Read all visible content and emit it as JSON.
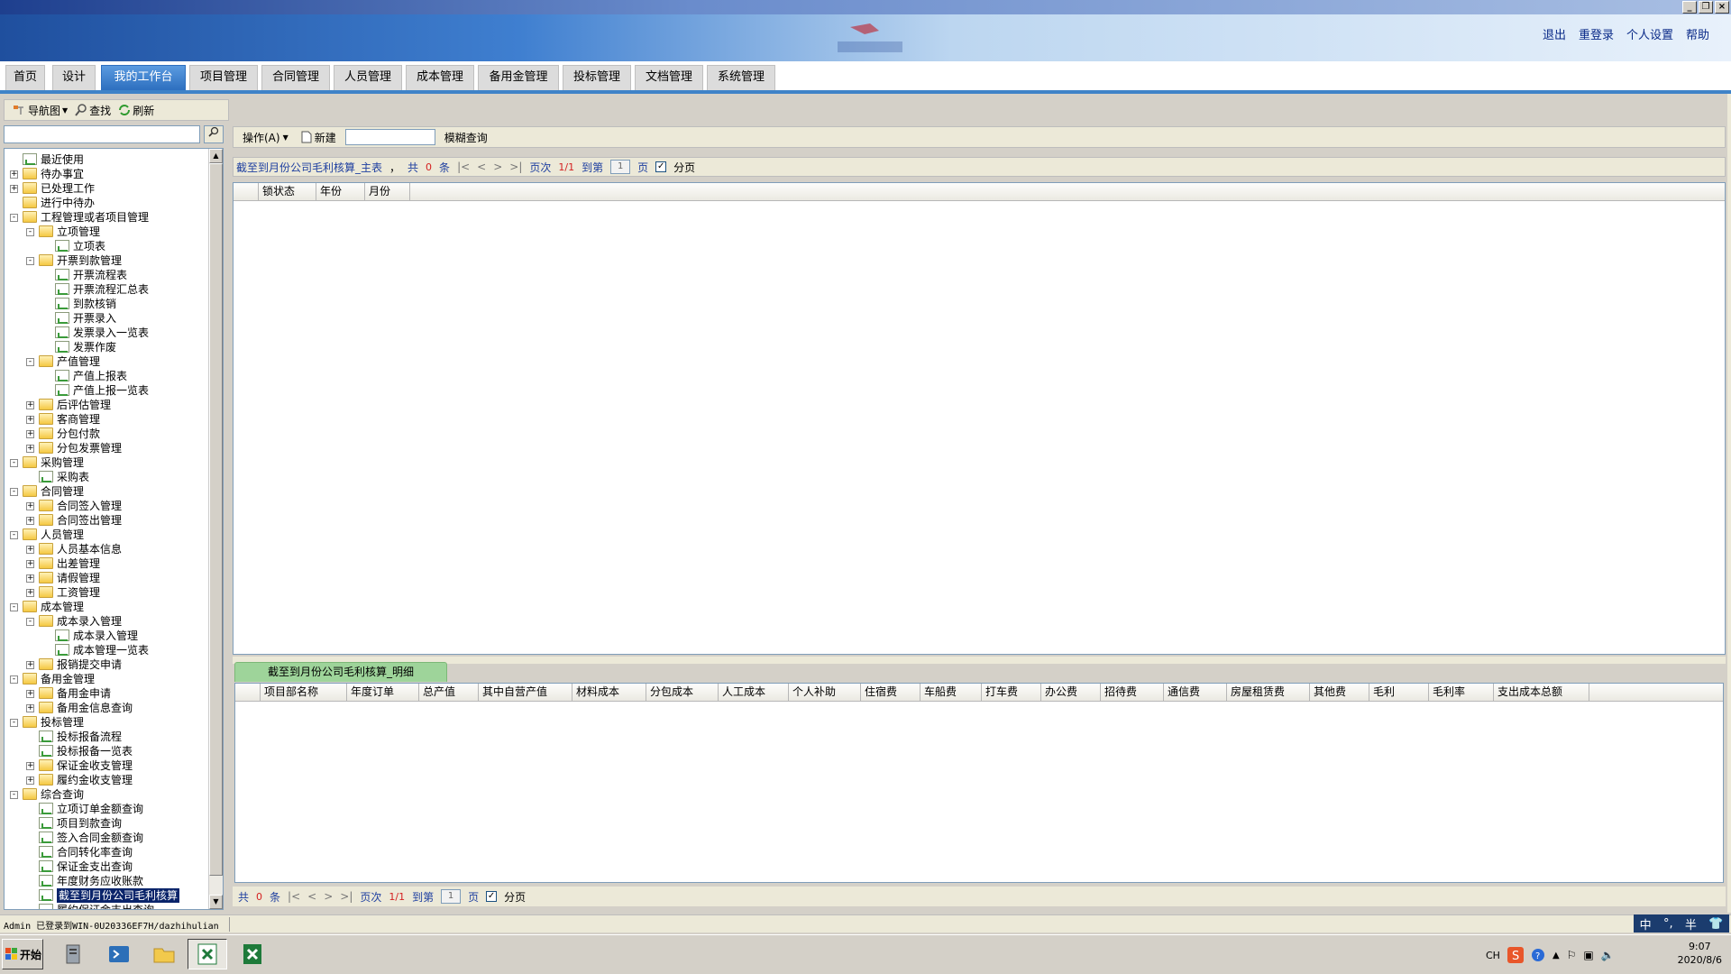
{
  "window": {
    "title": "",
    "controls": [
      "_",
      "❐",
      "×"
    ]
  },
  "banner": {
    "app_name": "",
    "links": [
      "退出",
      "重登录",
      "个人设置",
      "帮助"
    ]
  },
  "nav_tabs": [
    "首页",
    "设计",
    "我的工作台",
    "项目管理",
    "合同管理",
    "人员管理",
    "成本管理",
    "备用金管理",
    "投标管理",
    "文档管理",
    "系统管理"
  ],
  "nav_active": "我的工作台",
  "left_toolbar": {
    "nav_label": "导航图",
    "find_label": "查找",
    "refresh_label": "刷新"
  },
  "search": {
    "value": "",
    "button_icon": "magnifier-icon"
  },
  "tree": [
    {
      "label": "最近使用",
      "level": 0,
      "type": "doc",
      "exp": ""
    },
    {
      "label": "待办事宜",
      "level": 0,
      "type": "folder",
      "exp": "+"
    },
    {
      "label": "已处理工作",
      "level": 0,
      "type": "folder",
      "exp": "+"
    },
    {
      "label": "进行中待办",
      "level": 0,
      "type": "folder",
      "exp": ""
    },
    {
      "label": "工程管理或者项目管理",
      "level": 0,
      "type": "folder",
      "exp": "-"
    },
    {
      "label": "立项管理",
      "level": 1,
      "type": "folder",
      "exp": "-"
    },
    {
      "label": "立项表",
      "level": 2,
      "type": "doc",
      "exp": ""
    },
    {
      "label": "开票到款管理",
      "level": 1,
      "type": "folder",
      "exp": "-"
    },
    {
      "label": "开票流程表",
      "level": 2,
      "type": "doc",
      "exp": ""
    },
    {
      "label": "开票流程汇总表",
      "level": 2,
      "type": "doc",
      "exp": ""
    },
    {
      "label": "到款核销",
      "level": 2,
      "type": "doc",
      "exp": ""
    },
    {
      "label": "开票录入",
      "level": 2,
      "type": "doc",
      "exp": ""
    },
    {
      "label": "发票录入一览表",
      "level": 2,
      "type": "doc",
      "exp": ""
    },
    {
      "label": "发票作废",
      "level": 2,
      "type": "doc",
      "exp": ""
    },
    {
      "label": "产值管理",
      "level": 1,
      "type": "folder",
      "exp": "-"
    },
    {
      "label": "产值上报表",
      "level": 2,
      "type": "doc",
      "exp": ""
    },
    {
      "label": "产值上报一览表",
      "level": 2,
      "type": "doc",
      "exp": ""
    },
    {
      "label": "后评估管理",
      "level": 1,
      "type": "folder",
      "exp": "+"
    },
    {
      "label": "客商管理",
      "level": 1,
      "type": "folder",
      "exp": "+"
    },
    {
      "label": "分包付款",
      "level": 1,
      "type": "folder",
      "exp": "+"
    },
    {
      "label": "分包发票管理",
      "level": 1,
      "type": "folder",
      "exp": "+"
    },
    {
      "label": "采购管理",
      "level": 0,
      "type": "folder",
      "exp": "-"
    },
    {
      "label": "采购表",
      "level": 1,
      "type": "doc",
      "exp": ""
    },
    {
      "label": "合同管理",
      "level": 0,
      "type": "folder",
      "exp": "-"
    },
    {
      "label": "合同签入管理",
      "level": 1,
      "type": "folder",
      "exp": "+"
    },
    {
      "label": "合同签出管理",
      "level": 1,
      "type": "folder",
      "exp": "+"
    },
    {
      "label": "人员管理",
      "level": 0,
      "type": "folder",
      "exp": "-"
    },
    {
      "label": "人员基本信息",
      "level": 1,
      "type": "folder",
      "exp": "+"
    },
    {
      "label": "出差管理",
      "level": 1,
      "type": "folder",
      "exp": "+"
    },
    {
      "label": "请假管理",
      "level": 1,
      "type": "folder",
      "exp": "+"
    },
    {
      "label": "工资管理",
      "level": 1,
      "type": "folder",
      "exp": "+"
    },
    {
      "label": "成本管理",
      "level": 0,
      "type": "folder",
      "exp": "-"
    },
    {
      "label": "成本录入管理",
      "level": 1,
      "type": "folder",
      "exp": "-"
    },
    {
      "label": "成本录入管理",
      "level": 2,
      "type": "doc",
      "exp": ""
    },
    {
      "label": "成本管理一览表",
      "level": 2,
      "type": "doc",
      "exp": ""
    },
    {
      "label": "报销提交申请",
      "level": 1,
      "type": "folder",
      "exp": "+"
    },
    {
      "label": "备用金管理",
      "level": 0,
      "type": "folder",
      "exp": "-"
    },
    {
      "label": "备用金申请",
      "level": 1,
      "type": "folder",
      "exp": "+"
    },
    {
      "label": "备用金信息查询",
      "level": 1,
      "type": "folder",
      "exp": "+"
    },
    {
      "label": "投标管理",
      "level": 0,
      "type": "folder",
      "exp": "-"
    },
    {
      "label": "投标报备流程",
      "level": 1,
      "type": "doc",
      "exp": ""
    },
    {
      "label": "投标报备一览表",
      "level": 1,
      "type": "doc",
      "exp": ""
    },
    {
      "label": "保证金收支管理",
      "level": 1,
      "type": "folder",
      "exp": "+"
    },
    {
      "label": "履约金收支管理",
      "level": 1,
      "type": "folder",
      "exp": "+"
    },
    {
      "label": "综合查询",
      "level": 0,
      "type": "folder",
      "exp": "-"
    },
    {
      "label": "立项订单金额查询",
      "level": 1,
      "type": "doc",
      "exp": ""
    },
    {
      "label": "项目到款查询",
      "level": 1,
      "type": "doc",
      "exp": ""
    },
    {
      "label": "签入合同金额查询",
      "level": 1,
      "type": "doc",
      "exp": ""
    },
    {
      "label": "合同转化率查询",
      "level": 1,
      "type": "doc",
      "exp": ""
    },
    {
      "label": "保证金支出查询",
      "level": 1,
      "type": "doc",
      "exp": ""
    },
    {
      "label": "年度财务应收账款",
      "level": 1,
      "type": "doc",
      "exp": ""
    },
    {
      "label": "截至到月份公司毛利核算",
      "level": 1,
      "type": "doc",
      "exp": "",
      "selected": true
    },
    {
      "label": "履约保证金支出查询",
      "level": 1,
      "type": "doc",
      "exp": ""
    }
  ],
  "right_toolbar": {
    "operate_label": "操作(A)",
    "new_label": "新建",
    "search_value": "",
    "fuzzy_label": "模糊查询"
  },
  "pager_top": {
    "title": "截至到月份公司毛利核算_主表",
    "comma": "，",
    "total_prefix": "共",
    "count": "0",
    "unit": "条",
    "first": "|<",
    "prev": "<",
    "next": ">",
    "last": ">|",
    "page_label": "页次",
    "page_value": "1/1",
    "goto_label": "到第",
    "goto_value": "1",
    "page_unit": "页",
    "paging_label": "分页",
    "paging_checked": "✓"
  },
  "grid1": {
    "columns": [
      "",
      "锁状态",
      "年份",
      "月份"
    ]
  },
  "detail": {
    "tab_label": "截至到月份公司毛利核算_明细",
    "columns": [
      "",
      "项目部名称",
      "年度订单",
      "总产值",
      "其中自营产值",
      "材料成本",
      "分包成本",
      "人工成本",
      "个人补助",
      "住宿费",
      "车船费",
      "打车费",
      "办公费",
      "招待费",
      "通信费",
      "房屋租赁费",
      "其他费",
      "毛利",
      "毛利率",
      "支出成本总额"
    ]
  },
  "pager_bot": {
    "total_prefix": "共",
    "count": "0",
    "unit": "条",
    "first": "|<",
    "prev": "<",
    "next": ">",
    "last": ">|",
    "page_label": "页次",
    "page_value": "1/1",
    "goto_label": "到第",
    "goto_value": "1",
    "page_unit": "页",
    "paging_label": "分页",
    "paging_checked": "✓"
  },
  "status": {
    "text": "Admin 已登录到WIN-0U20336EF7H/dazhihulian"
  },
  "ime": {
    "lang": "中",
    "punct": "°,",
    "mode": "半"
  },
  "taskbar": {
    "start_label": "开始",
    "lang": "CH",
    "time": "9:07",
    "date": "2020/8/6"
  },
  "colors": {
    "accent": "#3f83c8",
    "tab_active": "#2d6fbf",
    "detail_tab": "#9ed49a",
    "selection": "#0a246a"
  }
}
